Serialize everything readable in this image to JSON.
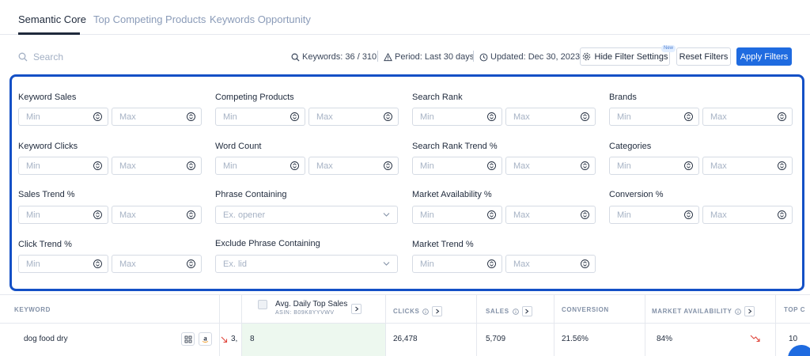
{
  "tabs": [
    {
      "label": "Semantic Core"
    },
    {
      "label": "Top Competing Products"
    },
    {
      "label": "Keywords Opportunity"
    }
  ],
  "toolbar": {
    "search_placeholder": "Search",
    "keywords": "Keywords: 36 / 310",
    "period": "Period: Last 30 days",
    "updated": "Updated: Dec 30, 2023",
    "hide_filters_label": "Hide Filter Settings",
    "new_badge": "New",
    "reset_label": "Reset Filters",
    "apply_label": "Apply Filters"
  },
  "filters": {
    "min_placeholder": "Min",
    "max_placeholder": "Max",
    "keyword_sales": "Keyword Sales",
    "keyword_clicks": "Keyword Clicks",
    "sales_trend": "Sales Trend %",
    "click_trend": "Click Trend %",
    "competing_products": "Competing Products",
    "word_count": "Word Count",
    "phrase_containing": "Phrase Containing",
    "phrase_placeholder": "Ex. opener",
    "exclude_phrase": "Exclude Phrase Containing",
    "exclude_placeholder": "Ex. lid",
    "search_rank": "Search Rank",
    "search_rank_trend": "Search Rank Trend %",
    "market_availability": "Market Availability %",
    "market_trend": "Market Trend %",
    "brands": "Brands",
    "categories": "Categories",
    "conversion": "Conversion %"
  },
  "table": {
    "headers": {
      "keyword": "KEYWORD",
      "avg_daily": "Avg. Daily Top Sales",
      "asin": "ASIN: B09K8YYVWV",
      "clicks": "CLICKS",
      "sales": "SALES",
      "conversion": "CONVERSION",
      "market_availability": "MARKET AVAILABILITY",
      "top": "TOP C"
    },
    "row": {
      "keyword": "dog food dry",
      "partial": "3,",
      "avg_daily": "8",
      "clicks": "26,478",
      "sales": "5,709",
      "conversion": "21.56%",
      "market_availability": "84%",
      "top": "10"
    }
  },
  "colors": {
    "accent": "#1f6be0",
    "panel_border": "#1450c6",
    "trend_down": "#e0463c"
  }
}
